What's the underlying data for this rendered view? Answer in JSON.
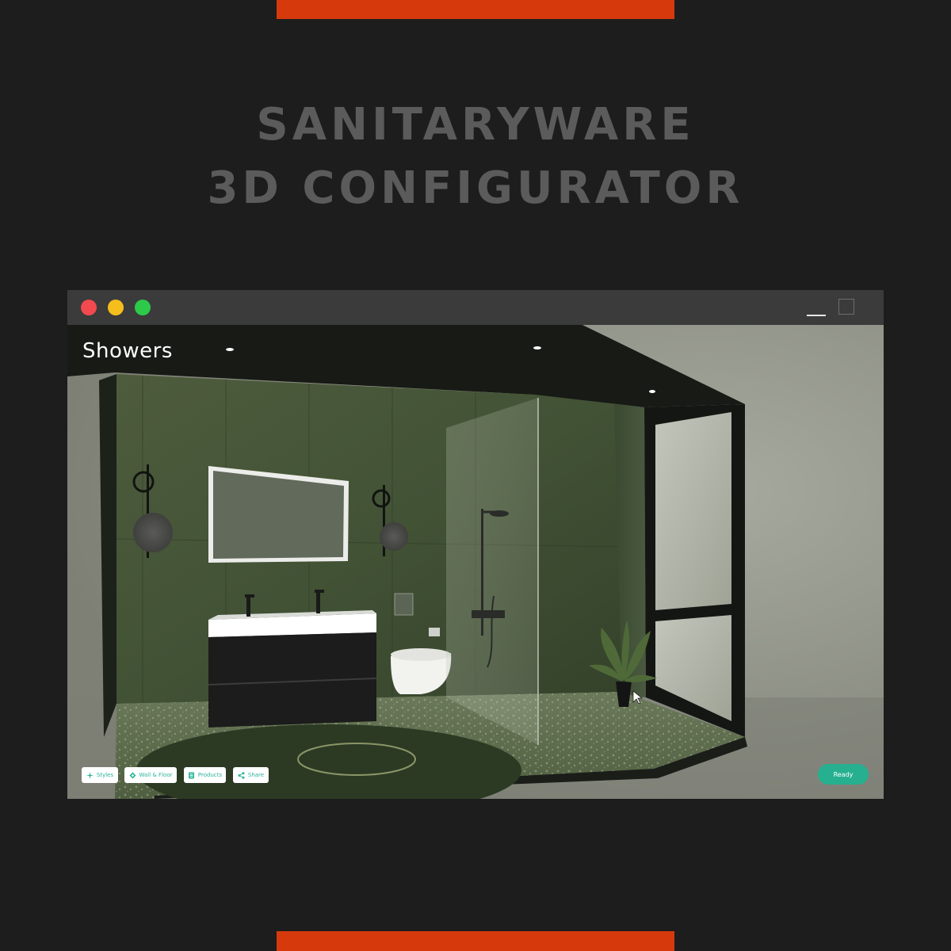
{
  "headline": {
    "line1": "SANITARYWARE",
    "line2": "3D CONFIGURATOR"
  },
  "colors": {
    "accent": "#d63a0c",
    "background": "#1d1d1d",
    "headline": "#5b5b5b",
    "button_text": "#2bb39a",
    "ready_button": "#27b08f"
  },
  "window": {
    "controls": [
      "close-dot",
      "minimize-dot",
      "zoom-dot"
    ],
    "right_controls": [
      "minimize-icon",
      "maximize-icon"
    ]
  },
  "scene": {
    "title": "Showers"
  },
  "toolbar": {
    "buttons": [
      {
        "label": "Styles",
        "icon": "sparkle-icon"
      },
      {
        "label": "Wall & Floor",
        "icon": "layers-icon"
      },
      {
        "label": "Products",
        "icon": "list-icon"
      },
      {
        "label": "Share",
        "icon": "share-icon"
      }
    ]
  },
  "ready_button": {
    "label": "Ready"
  }
}
